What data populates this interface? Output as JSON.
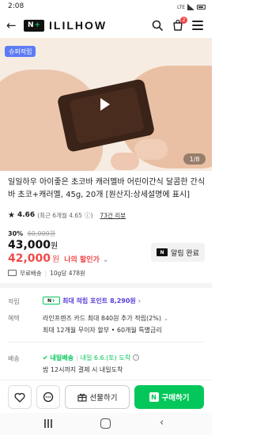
{
  "status": {
    "time": "2:08",
    "network": "LTE"
  },
  "header": {
    "logo_badge_n": "N",
    "logo_badge_plus": "+",
    "logo_text": "ILILHOW",
    "cart_count": "2"
  },
  "hero": {
    "badge": "슈퍼적립",
    "pager": "1/8"
  },
  "product": {
    "title": "일일하우 아이좋은 초코바 캐러멜바 어린이간식 달콤한 간식바 초코+캐러멜, 45g, 20개 [원산지:상세설명에 표시]",
    "rating": "4.66",
    "recent_rating": "(최근 6개월 4.65",
    "review_count": "73건 리뷰",
    "discount_pct": "30%",
    "original_price": "60,000원",
    "price": "43,000",
    "price_unit": "원",
    "sale_price": "42,000",
    "sale_unit": "원",
    "lowest_label": "나의 할인가",
    "notify_button": "알림 완료",
    "shipping": "무료배송",
    "unit_price": "10g당 478원"
  },
  "details": {
    "points_label": "적립",
    "points_text": "최대 적립 포인트",
    "points_value": "8,290원",
    "benefit_label": "혜택",
    "benefit_line1": "라인프렌즈 카드 최대 840원 추가 적립(2%)",
    "benefit_line2": "최대 12개월 무이자 할부 • 60개월 특별금리",
    "delivery_label": "배송",
    "delivery_badge": "내일배송",
    "delivery_date": "내일 6.6.(토) 도착",
    "delivery_note": "밤 12시까지 결제 시 내일도착"
  },
  "bottom": {
    "gift_label": "선물하기",
    "buy_label": "구매하기",
    "buy_badge": "N"
  },
  "colors": {
    "brand_green": "#03c75a",
    "sale_red": "#f04a4a",
    "points_purple": "#5a3dd8",
    "super_badge_blue": "#5d7bf5"
  }
}
